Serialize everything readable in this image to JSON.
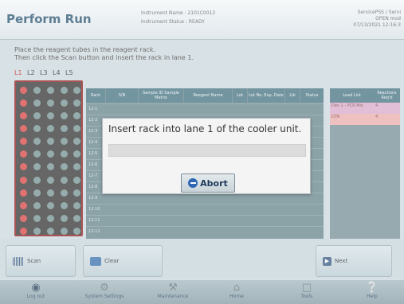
{
  "header": {
    "title": "Perform Run",
    "instrument_name": "Instrument Name : 2101C0012",
    "instrument_status": "Instrument Status : READY",
    "service_user": "ServicePSS / Servi",
    "online_status": "OPEN mod",
    "datetime": "07/13/2021 12:16:3"
  },
  "instruction": {
    "line1": "Place the reagent tubes in the reagent rack.",
    "line2": "Then click the Scan button and insert the rack in lane 1."
  },
  "lanes": [
    "L1",
    "L2",
    "L3",
    "L4",
    "L5"
  ],
  "grid": {
    "columns": [
      "Rack",
      "S/N",
      "Sample ID Sample Matrix",
      "Reagent Name",
      "Lot",
      "Lot No. Exp. Date",
      "Lib",
      "Status"
    ],
    "row_ids": [
      "12-1",
      "12-2",
      "12-3",
      "12-4",
      "12-5",
      "12-6",
      "12-7",
      "12-8",
      "12-9",
      "12-10",
      "12-11",
      "12-12"
    ]
  },
  "load_list": {
    "columns": [
      "Load List",
      "Reactions Req'd"
    ],
    "rows": [
      {
        "name": "Dev 1 - PCR Mix",
        "count": "4",
        "color": "#d8a6c8"
      },
      {
        "name": "DTR",
        "count": "4",
        "color": "#e8a8a8"
      }
    ]
  },
  "actions": {
    "scan_label": "Scan",
    "clear_label": "Clear",
    "next_label": "Next"
  },
  "footer": {
    "items": [
      "Log out",
      "System Settings",
      "Maintenance",
      "Home",
      "Tools",
      "Help"
    ]
  },
  "dialog": {
    "message": "Insert rack into lane 1 of the cooler unit.",
    "abort_label": "Abort"
  },
  "colors": {
    "accent": "#2d67b3",
    "grid_header": "#3d6c7c",
    "active_lane": "#c01818"
  }
}
